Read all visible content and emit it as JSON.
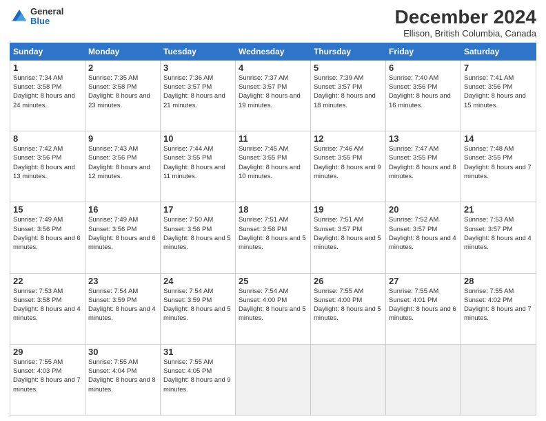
{
  "logo": {
    "general": "General",
    "blue": "Blue"
  },
  "title": "December 2024",
  "subtitle": "Ellison, British Columbia, Canada",
  "header_days": [
    "Sunday",
    "Monday",
    "Tuesday",
    "Wednesday",
    "Thursday",
    "Friday",
    "Saturday"
  ],
  "weeks": [
    [
      {
        "day": "1",
        "sunrise": "7:34 AM",
        "sunset": "3:58 PM",
        "daylight": "8 hours and 24 minutes."
      },
      {
        "day": "2",
        "sunrise": "7:35 AM",
        "sunset": "3:58 PM",
        "daylight": "8 hours and 23 minutes."
      },
      {
        "day": "3",
        "sunrise": "7:36 AM",
        "sunset": "3:57 PM",
        "daylight": "8 hours and 21 minutes."
      },
      {
        "day": "4",
        "sunrise": "7:37 AM",
        "sunset": "3:57 PM",
        "daylight": "8 hours and 19 minutes."
      },
      {
        "day": "5",
        "sunrise": "7:39 AM",
        "sunset": "3:57 PM",
        "daylight": "8 hours and 18 minutes."
      },
      {
        "day": "6",
        "sunrise": "7:40 AM",
        "sunset": "3:56 PM",
        "daylight": "8 hours and 16 minutes."
      },
      {
        "day": "7",
        "sunrise": "7:41 AM",
        "sunset": "3:56 PM",
        "daylight": "8 hours and 15 minutes."
      }
    ],
    [
      {
        "day": "8",
        "sunrise": "7:42 AM",
        "sunset": "3:56 PM",
        "daylight": "8 hours and 13 minutes."
      },
      {
        "day": "9",
        "sunrise": "7:43 AM",
        "sunset": "3:56 PM",
        "daylight": "8 hours and 12 minutes."
      },
      {
        "day": "10",
        "sunrise": "7:44 AM",
        "sunset": "3:55 PM",
        "daylight": "8 hours and 11 minutes."
      },
      {
        "day": "11",
        "sunrise": "7:45 AM",
        "sunset": "3:55 PM",
        "daylight": "8 hours and 10 minutes."
      },
      {
        "day": "12",
        "sunrise": "7:46 AM",
        "sunset": "3:55 PM",
        "daylight": "8 hours and 9 minutes."
      },
      {
        "day": "13",
        "sunrise": "7:47 AM",
        "sunset": "3:55 PM",
        "daylight": "8 hours and 8 minutes."
      },
      {
        "day": "14",
        "sunrise": "7:48 AM",
        "sunset": "3:55 PM",
        "daylight": "8 hours and 7 minutes."
      }
    ],
    [
      {
        "day": "15",
        "sunrise": "7:49 AM",
        "sunset": "3:56 PM",
        "daylight": "8 hours and 6 minutes."
      },
      {
        "day": "16",
        "sunrise": "7:49 AM",
        "sunset": "3:56 PM",
        "daylight": "8 hours and 6 minutes."
      },
      {
        "day": "17",
        "sunrise": "7:50 AM",
        "sunset": "3:56 PM",
        "daylight": "8 hours and 5 minutes."
      },
      {
        "day": "18",
        "sunrise": "7:51 AM",
        "sunset": "3:56 PM",
        "daylight": "8 hours and 5 minutes."
      },
      {
        "day": "19",
        "sunrise": "7:51 AM",
        "sunset": "3:57 PM",
        "daylight": "8 hours and 5 minutes."
      },
      {
        "day": "20",
        "sunrise": "7:52 AM",
        "sunset": "3:57 PM",
        "daylight": "8 hours and 4 minutes."
      },
      {
        "day": "21",
        "sunrise": "7:53 AM",
        "sunset": "3:57 PM",
        "daylight": "8 hours and 4 minutes."
      }
    ],
    [
      {
        "day": "22",
        "sunrise": "7:53 AM",
        "sunset": "3:58 PM",
        "daylight": "8 hours and 4 minutes."
      },
      {
        "day": "23",
        "sunrise": "7:54 AM",
        "sunset": "3:59 PM",
        "daylight": "8 hours and 4 minutes."
      },
      {
        "day": "24",
        "sunrise": "7:54 AM",
        "sunset": "3:59 PM",
        "daylight": "8 hours and 5 minutes."
      },
      {
        "day": "25",
        "sunrise": "7:54 AM",
        "sunset": "4:00 PM",
        "daylight": "8 hours and 5 minutes."
      },
      {
        "day": "26",
        "sunrise": "7:55 AM",
        "sunset": "4:00 PM",
        "daylight": "8 hours and 5 minutes."
      },
      {
        "day": "27",
        "sunrise": "7:55 AM",
        "sunset": "4:01 PM",
        "daylight": "8 hours and 6 minutes."
      },
      {
        "day": "28",
        "sunrise": "7:55 AM",
        "sunset": "4:02 PM",
        "daylight": "8 hours and 7 minutes."
      }
    ],
    [
      {
        "day": "29",
        "sunrise": "7:55 AM",
        "sunset": "4:03 PM",
        "daylight": "8 hours and 7 minutes."
      },
      {
        "day": "30",
        "sunrise": "7:55 AM",
        "sunset": "4:04 PM",
        "daylight": "8 hours and 8 minutes."
      },
      {
        "day": "31",
        "sunrise": "7:55 AM",
        "sunset": "4:05 PM",
        "daylight": "8 hours and 9 minutes."
      },
      null,
      null,
      null,
      null
    ]
  ]
}
